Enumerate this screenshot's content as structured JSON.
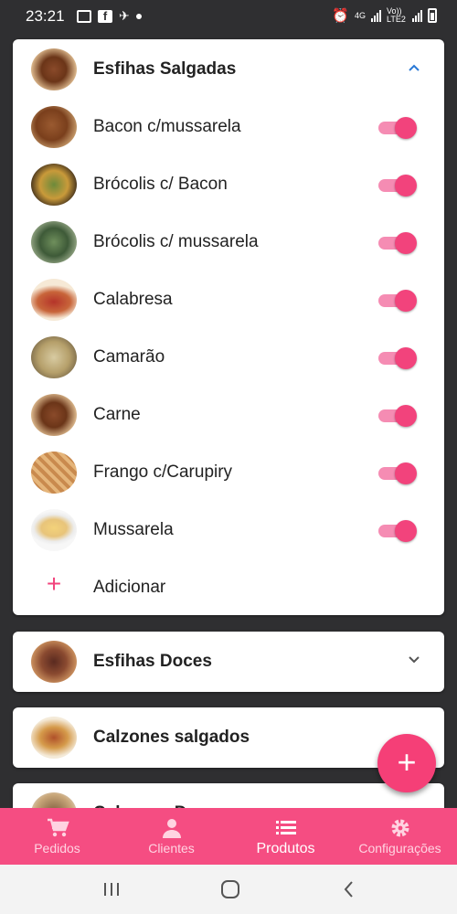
{
  "status_bar": {
    "time": "23:21",
    "network": "4G",
    "network2": "Vo)) LTE2"
  },
  "colors": {
    "accent": "#f2437c",
    "nav_background": "#f54d82",
    "fab": "#f53f77"
  },
  "categories": [
    {
      "name": "Esfihas Salgadas",
      "expanded": true,
      "items": [
        {
          "label": "Bacon c/mussarela",
          "enabled": true
        },
        {
          "label": "Brócolis c/ Bacon",
          "enabled": true
        },
        {
          "label": "Brócolis c/ mussarela",
          "enabled": true
        },
        {
          "label": "Calabresa",
          "enabled": true
        },
        {
          "label": "Camarão",
          "enabled": true
        },
        {
          "label": "Carne",
          "enabled": true
        },
        {
          "label": "Frango c/Carupiry",
          "enabled": true
        },
        {
          "label": "Mussarela",
          "enabled": true
        }
      ],
      "add_label": "Adicionar"
    },
    {
      "name": "Esfihas Doces",
      "expanded": false
    },
    {
      "name": "Calzones salgados",
      "expanded": false
    },
    {
      "name": "Calzones Doces",
      "expanded": false
    }
  ],
  "fab": {
    "icon": "plus-icon",
    "label": "+"
  },
  "bottom_nav": [
    {
      "label": "Pedidos",
      "icon": "cart-icon",
      "active": false
    },
    {
      "label": "Clientes",
      "icon": "person-icon",
      "active": false
    },
    {
      "label": "Produtos",
      "icon": "list-icon",
      "active": true
    },
    {
      "label": "Configurações",
      "icon": "gear-icon",
      "active": false
    }
  ]
}
